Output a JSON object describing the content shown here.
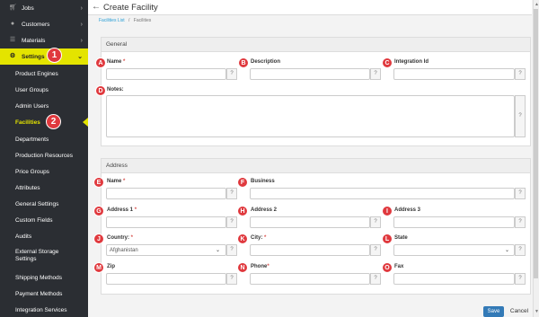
{
  "sidebar": {
    "top_items": [
      {
        "label": "Jobs",
        "icon": "cart-icon"
      },
      {
        "label": "Customers",
        "icon": "users-icon"
      },
      {
        "label": "Materials",
        "icon": "layers-icon"
      },
      {
        "label": "Settings",
        "icon": "gear-icon"
      }
    ],
    "sub_items": [
      "Product Engines",
      "User Groups",
      "Admin Users",
      "Facilities",
      "Departments",
      "Production Resources",
      "Price Groups",
      "Attributes",
      "General Settings",
      "Custom Fields",
      "Audits",
      "External Storage Settings",
      "Shipping Methods",
      "Payment Methods",
      "Integration Services"
    ],
    "active_item": "Facilities"
  },
  "step_badges": [
    "1",
    "2"
  ],
  "header": {
    "back_icon": "arrow-left-icon",
    "title": "Create Facility"
  },
  "breadcrumb": {
    "link": "Facilities List",
    "separator": "/",
    "current": "Facilities"
  },
  "general": {
    "title": "General",
    "fields": {
      "name": {
        "marker": "A",
        "label": "Name",
        "required": "*"
      },
      "description": {
        "marker": "B",
        "label": "Description"
      },
      "integration_id": {
        "marker": "C",
        "label": "Integration Id"
      },
      "notes": {
        "marker": "D",
        "label": "Notes:"
      }
    }
  },
  "address": {
    "title": "Address",
    "fields": {
      "name": {
        "marker": "E",
        "label": "Name",
        "required": "*"
      },
      "business": {
        "marker": "F",
        "label": "Business"
      },
      "address1": {
        "marker": "G",
        "label": "Address 1",
        "required": "*"
      },
      "address2": {
        "marker": "H",
        "label": "Address 2"
      },
      "address3": {
        "marker": "I",
        "label": "Address 3"
      },
      "country": {
        "marker": "J",
        "label": "Country:",
        "required": "*",
        "value": "Afghanistan"
      },
      "city": {
        "marker": "K",
        "label": "City:",
        "required": "*"
      },
      "state": {
        "marker": "L",
        "label": "State",
        "value": ""
      },
      "zip": {
        "marker": "M",
        "label": "Zip"
      },
      "phone": {
        "marker": "N",
        "label": "Phone",
        "required": "*"
      },
      "fax": {
        "marker": "O",
        "label": "Fax"
      }
    }
  },
  "help_label": "?",
  "buttons": {
    "save": "Save",
    "cancel": "Cancel"
  },
  "colors": {
    "accent": "#e4e400",
    "marker": "#e0393e",
    "primary": "#337ab7",
    "link": "#2a9fd6"
  }
}
